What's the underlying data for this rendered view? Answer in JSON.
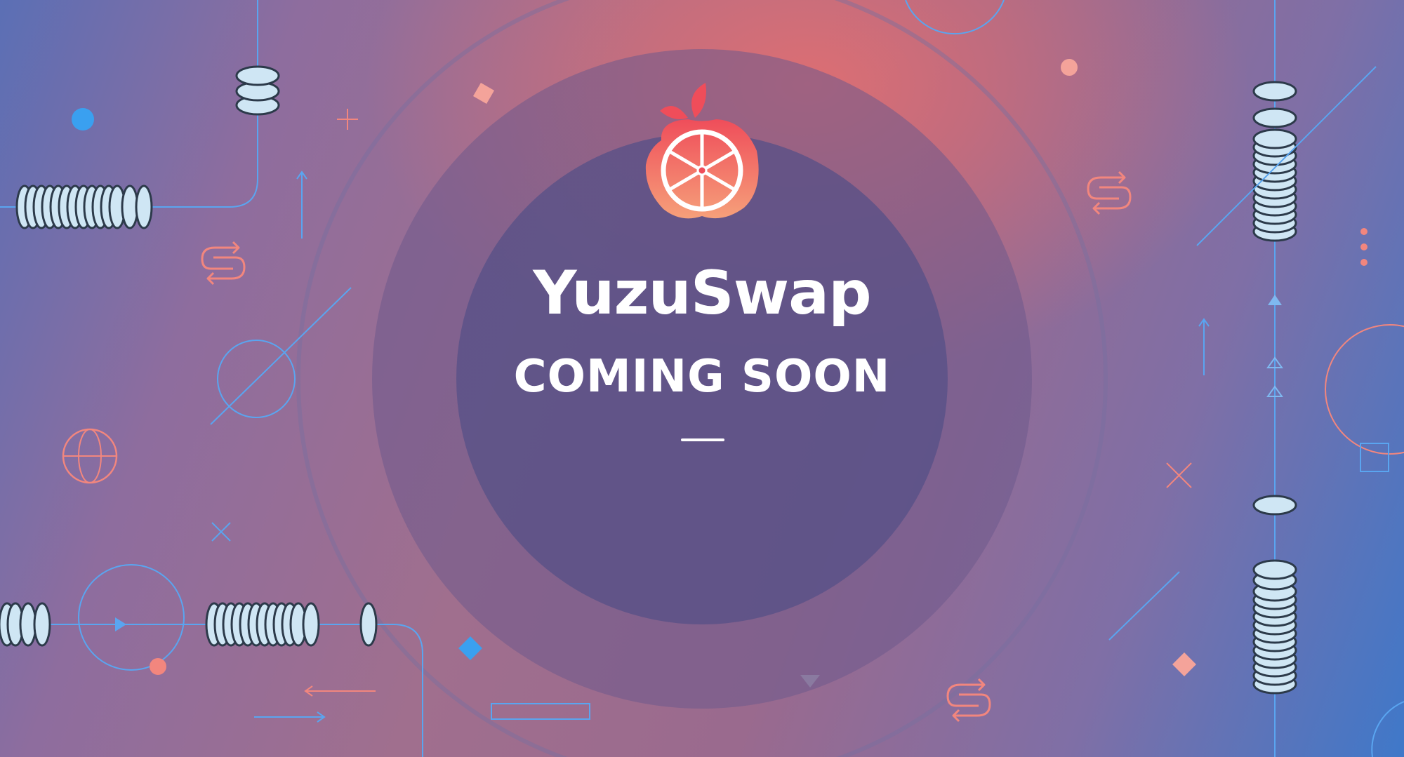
{
  "brand": {
    "name": "YuzuSwap",
    "tagline": "COMING SOON"
  },
  "colors": {
    "accent_coral": "#f2867e",
    "line_blue": "#5aa5f0",
    "coin_fill": "#cfe6f4",
    "coin_edge": "#2c3a4a",
    "logo_red": "#ef4d5a"
  },
  "icons": [
    "yuzu-logo-icon",
    "swap-arrows-icon",
    "globe-icon",
    "coin-stack-icon"
  ]
}
